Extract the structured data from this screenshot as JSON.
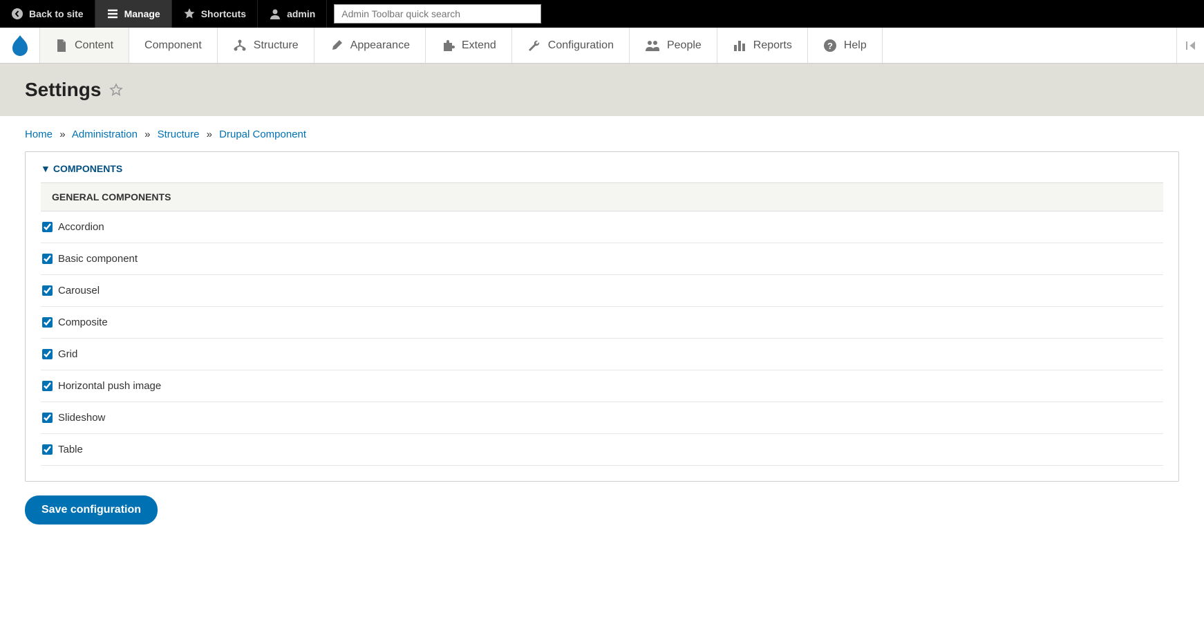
{
  "toolbar": {
    "back": "Back to site",
    "manage": "Manage",
    "shortcuts": "Shortcuts",
    "user": "admin",
    "search_placeholder": "Admin Toolbar quick search"
  },
  "admin_menu": [
    {
      "key": "content",
      "label": "Content"
    },
    {
      "key": "component",
      "label": "Component"
    },
    {
      "key": "structure",
      "label": "Structure"
    },
    {
      "key": "appearance",
      "label": "Appearance"
    },
    {
      "key": "extend",
      "label": "Extend"
    },
    {
      "key": "configuration",
      "label": "Configuration"
    },
    {
      "key": "people",
      "label": "People"
    },
    {
      "key": "reports",
      "label": "Reports"
    },
    {
      "key": "help",
      "label": "Help"
    }
  ],
  "page_title": "Settings",
  "breadcrumb": {
    "home": "Home",
    "administration": "Administration",
    "structure": "Structure",
    "drupal_component": "Drupal Component"
  },
  "fieldset_title": "COMPONENTS",
  "section_header": "GENERAL COMPONENTS",
  "components": [
    {
      "label": "Accordion",
      "checked": true
    },
    {
      "label": "Basic component",
      "checked": true
    },
    {
      "label": "Carousel",
      "checked": true
    },
    {
      "label": "Composite",
      "checked": true
    },
    {
      "label": "Grid",
      "checked": true
    },
    {
      "label": "Horizontal push image",
      "checked": true
    },
    {
      "label": "Slideshow",
      "checked": true
    },
    {
      "label": "Table",
      "checked": true
    }
  ],
  "save_label": "Save configuration"
}
